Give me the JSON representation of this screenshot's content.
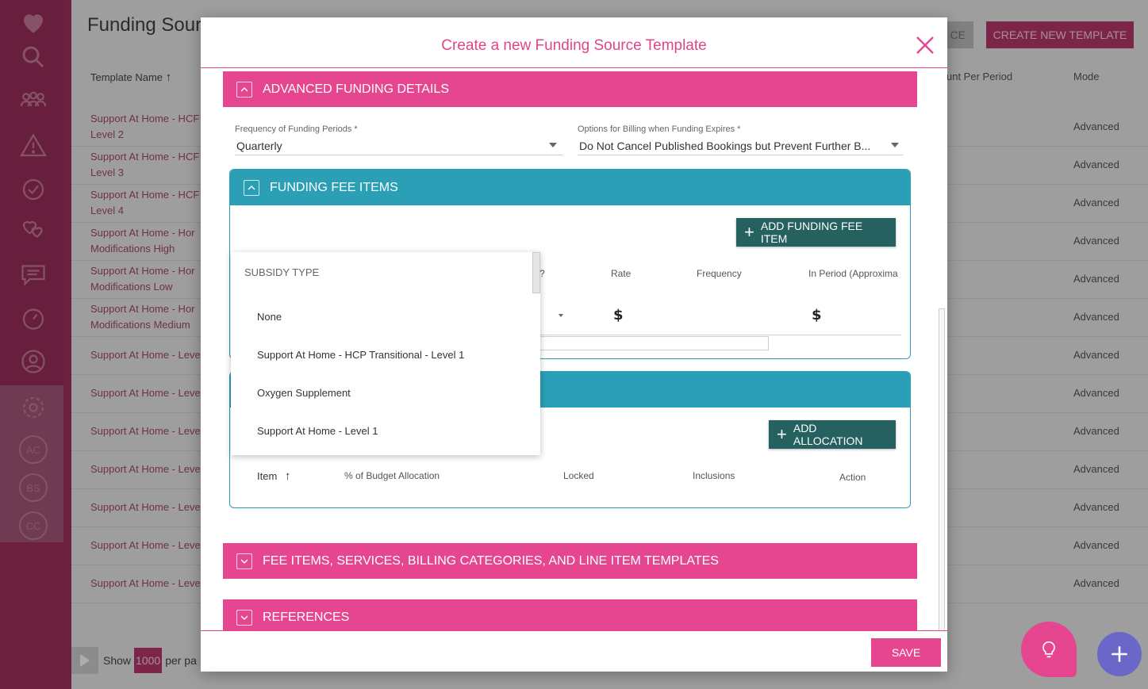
{
  "background": {
    "page_title": "Funding Sour",
    "buttons": {
      "ce_label": "CE",
      "create_template_label": "CREATE NEW TEMPLATE"
    },
    "table": {
      "col_template_name": "Template Name",
      "col_amount": "unt Per Period",
      "col_mode": "Mode",
      "rows": [
        {
          "name_line1": "Support At Home - HCF",
          "name_line2": "Level 2",
          "mode": "Advanced"
        },
        {
          "name_line1": "Support At Home - HCF",
          "name_line2": "Level 3",
          "mode": "Advanced"
        },
        {
          "name_line1": "Support At Home - HCF",
          "name_line2": "Level 4",
          "mode": "Advanced"
        },
        {
          "name_line1": "Support At Home - Hor",
          "name_line2": "Modifications High",
          "mode": "Advanced"
        },
        {
          "name_line1": "Support At Home - Hor",
          "name_line2": "Modifications Low",
          "mode": "Advanced"
        },
        {
          "name_line1": "Support At Home - Hor",
          "name_line2": "Modifications Medium",
          "mode": "Advanced"
        },
        {
          "name_line1": "Support At Home - Leve",
          "name_line2": "",
          "mode": "Advanced"
        },
        {
          "name_line1": "Support At Home - Leve",
          "name_line2": "",
          "mode": "Advanced"
        },
        {
          "name_line1": "Support At Home - Leve",
          "name_line2": "",
          "mode": "Advanced"
        },
        {
          "name_line1": "Support At Home - Leve",
          "name_line2": "",
          "mode": "Advanced"
        },
        {
          "name_line1": "Support At Home - Leve",
          "name_line2": "",
          "mode": "Advanced"
        },
        {
          "name_line1": "Support At Home - Leve",
          "name_line2": "",
          "mode": "Advanced"
        },
        {
          "name_line1": "Support At Home - Leve",
          "name_line2": "",
          "mode": "Advanced"
        }
      ]
    },
    "pager": {
      "show": "Show",
      "count": "1000",
      "per_page": "per pa"
    }
  },
  "sidebar": {
    "icons": [
      "heart-icon",
      "search-icon",
      "people-icon",
      "alert-icon",
      "clock-check-icon",
      "hearts-icon",
      "chat-icon",
      "gauge-icon",
      "user-icon",
      "gear-icon"
    ],
    "circles": [
      "AC",
      "BS",
      "CC"
    ]
  },
  "modal": {
    "title": "Create a new Funding Source Template",
    "sections": {
      "advanced": "ADVANCED FUNDING DETAILS",
      "fee_items_services": "FEE ITEMS, SERVICES, BILLING CATEGORIES, AND LINE ITEM TEMPLATES",
      "references": "REFERENCES"
    },
    "fields": {
      "frequency_label": "Frequency of Funding Periods *",
      "frequency_value": "Quarterly",
      "billing_label": "Options for Billing when Funding Expires *",
      "billing_value": "Do Not Cancel Published Bookings but Prevent Further B..."
    },
    "funding_fee_items": {
      "title": "FUNDING FEE ITEMS",
      "add_button": "ADD FUNDING FEE ITEM",
      "columns": {
        "q": "?",
        "rate": "Rate",
        "frequency": "Frequency",
        "in_period": "In Period (Approxima"
      },
      "row": {
        "rate_symbol": "$",
        "in_period_symbol": "$"
      }
    },
    "allocation": {
      "add_button": "ADD ALLOCATION",
      "columns": {
        "item": "Item",
        "budget": "% of Budget Allocation",
        "locked": "Locked",
        "inclusions": "Inclusions",
        "action": "Action"
      }
    },
    "dropdown": {
      "header": "SUBSIDY TYPE",
      "options": [
        "None",
        "Support At Home - HCP Transitional - Level 1",
        "Oxygen Supplement",
        "Support At Home - Level 1"
      ]
    },
    "save_label": "SAVE"
  },
  "colors": {
    "brand_pink": "#e5468f",
    "teal": "#2a9fb5",
    "dark_teal": "#24615f",
    "sidebar": "#9a2f5a"
  }
}
